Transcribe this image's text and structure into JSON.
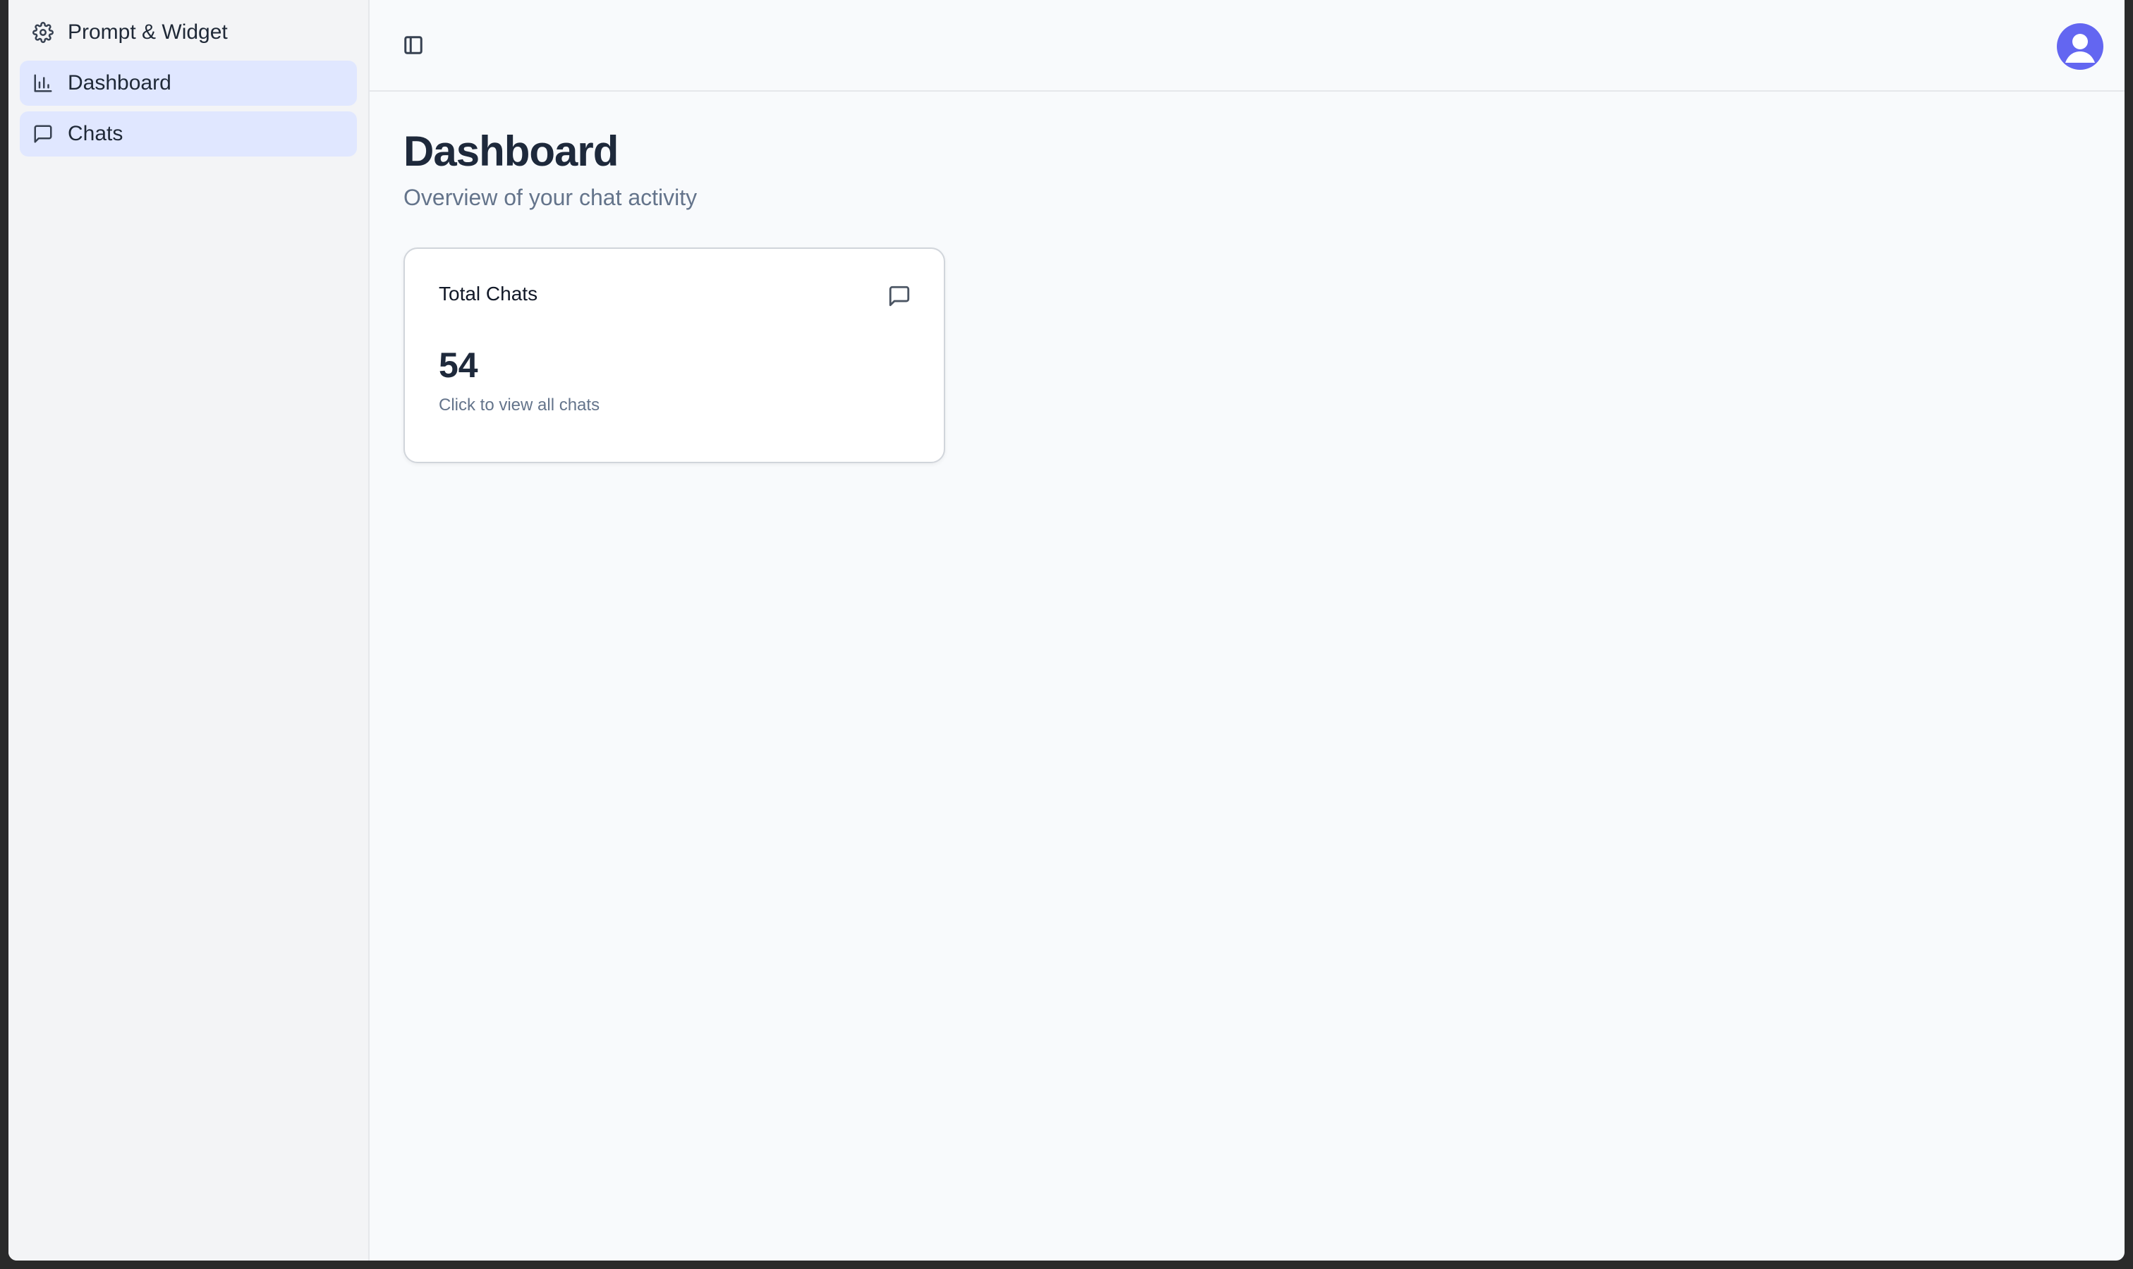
{
  "sidebar": {
    "items": [
      {
        "label": "Prompt & Widget",
        "icon": "gear-icon",
        "active": false
      },
      {
        "label": "Dashboard",
        "icon": "bar-chart-icon",
        "active": true
      },
      {
        "label": "Chats",
        "icon": "message-square-icon",
        "active": true
      }
    ]
  },
  "header": {
    "toggle_icon": "sidebar-toggle-icon",
    "avatar_icon": "user-avatar-icon",
    "avatar_color": "#6366f1"
  },
  "main": {
    "title": "Dashboard",
    "subtitle": "Overview of your chat activity",
    "cards": [
      {
        "title": "Total Chats",
        "value": "54",
        "hint": "Click to view all chats",
        "icon": "message-square-icon"
      }
    ]
  }
}
